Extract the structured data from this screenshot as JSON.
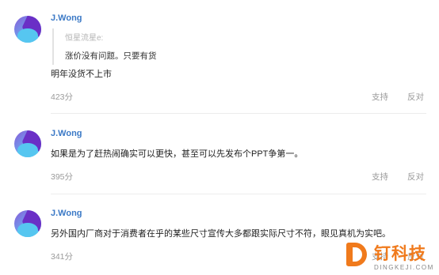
{
  "comments": [
    {
      "user": "J.Wong",
      "quote": {
        "author": "恒星流星e:",
        "text": "涨价没有问题。只要有货"
      },
      "text": "明年没货不上市",
      "score": "423分",
      "support_label": "支持",
      "oppose_label": "反对"
    },
    {
      "user": "J.Wong",
      "text": "如果是为了赶热闹确实可以更快，甚至可以先发布个PPT争第一。",
      "score": "395分",
      "support_label": "支持",
      "oppose_label": "反对"
    },
    {
      "user": "J.Wong",
      "text": "另外国内厂商对于消费者在乎的某些尺寸宣传大多都跟实际尺寸不符，眼见真机为实吧。",
      "score": "341分",
      "support_label": "支持",
      "oppose_label": "反对"
    }
  ],
  "watermark": {
    "brand": "钉科技",
    "domain": "DINGKEJI.COM"
  },
  "colors": {
    "username": "#3b79c6",
    "meta": "#9a9a9a",
    "brand": "#f07a1c"
  }
}
